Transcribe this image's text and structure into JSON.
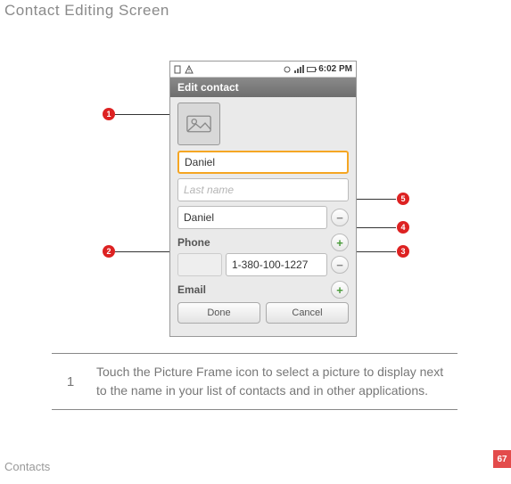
{
  "page_title": "Contact Editing Screen",
  "statusbar": {
    "time": "6:02 PM"
  },
  "titlebar": "Edit contact",
  "fields": {
    "first_name": "Daniel",
    "last_name_placeholder": "Last name",
    "nickname": "Daniel",
    "phone_label": "Phone",
    "phone_type": "",
    "phone_value": "1-380-100-1227",
    "email_label": "Email"
  },
  "buttons": {
    "done": "Done",
    "cancel": "Cancel"
  },
  "callouts": {
    "c1": "1",
    "c2": "2",
    "c3": "3",
    "c4": "4",
    "c5": "5"
  },
  "description": {
    "num": "1",
    "text": "Touch the Picture Frame icon to select a picture to display next to the name in your list of contacts and in other applications."
  },
  "footer": "Contacts",
  "page_number": "67"
}
